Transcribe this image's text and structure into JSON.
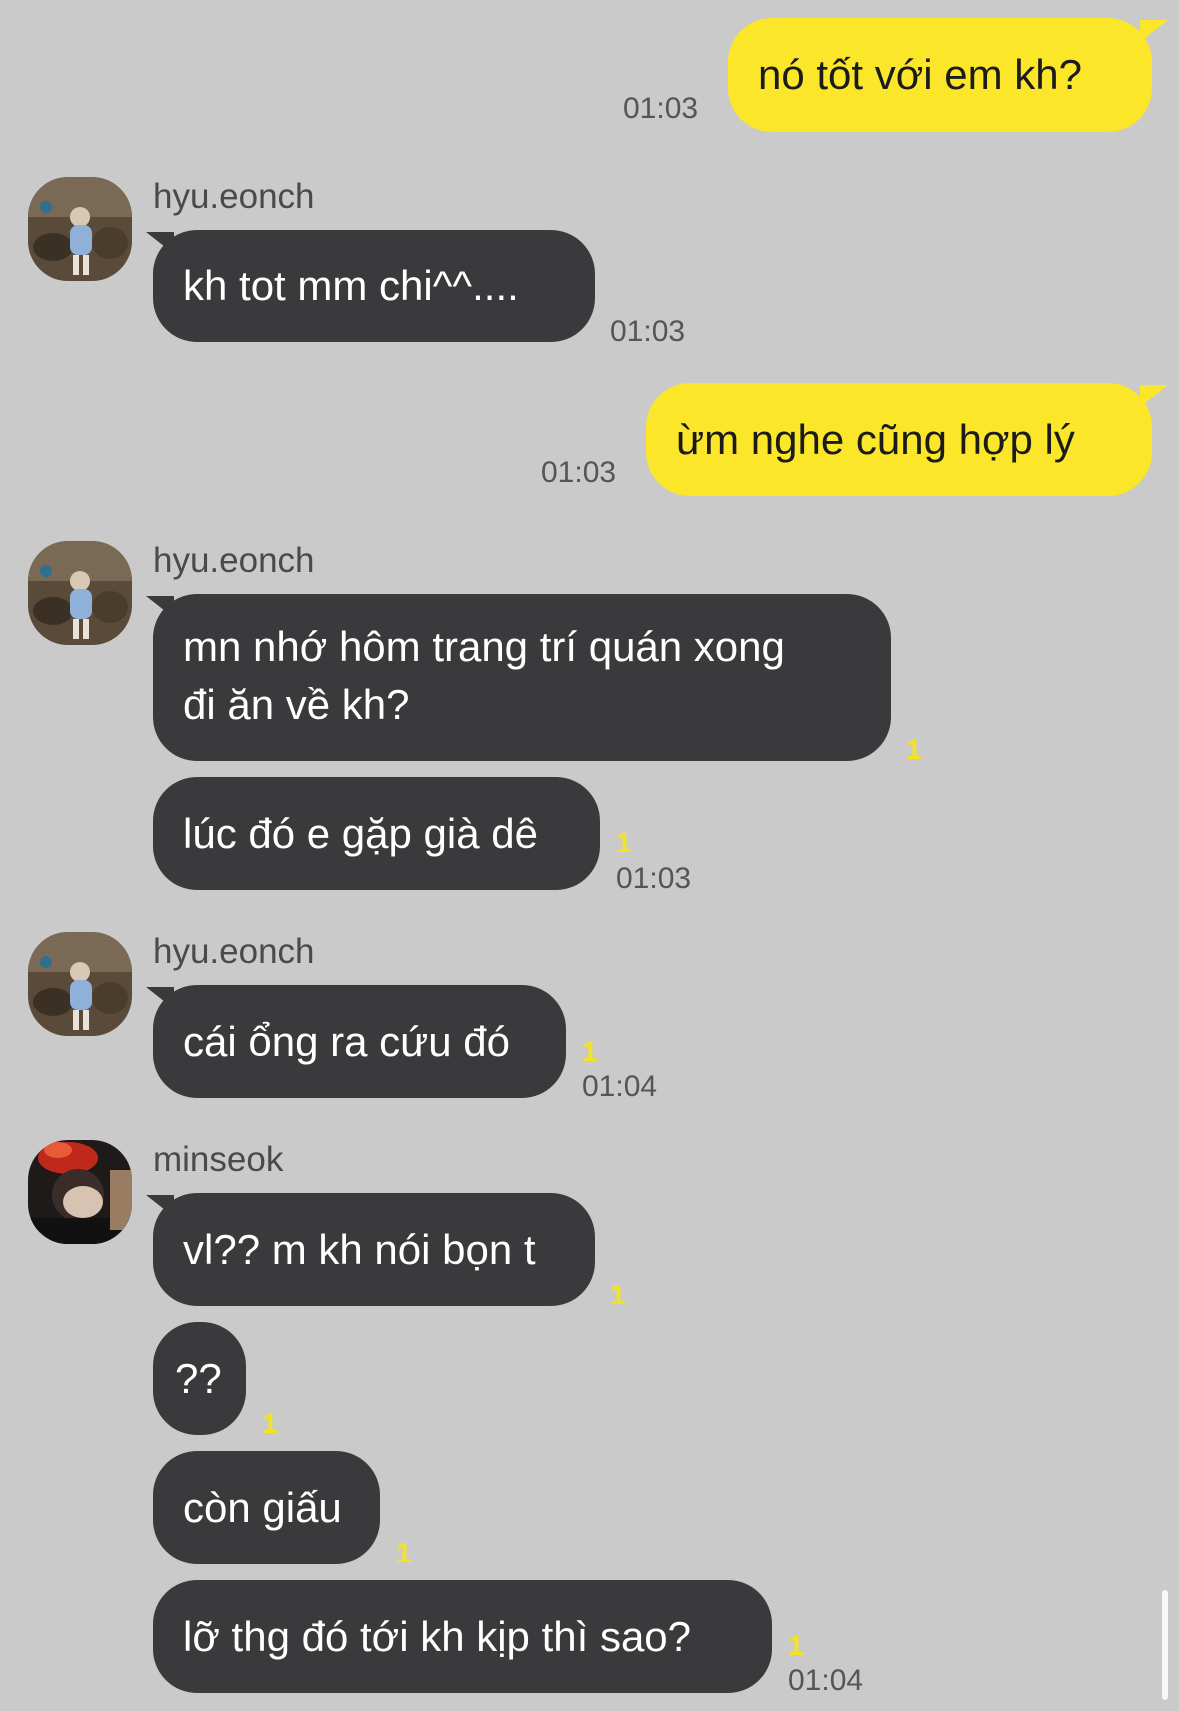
{
  "messages": {
    "m1": {
      "text": "nó tốt với em kh?",
      "time": "01:03"
    },
    "m2": {
      "sender": "hyu.eonch",
      "text": "kh tot mm chi^^....",
      "time": "01:03"
    },
    "m3": {
      "text": "ừm nghe cũng hợp lý",
      "time": "01:03"
    },
    "m4": {
      "sender": "hyu.eonch",
      "line1": "mn nhớ hôm trang trí quán xong",
      "line2": "đi ăn về kh?",
      "unread": "1"
    },
    "m5": {
      "text": "lúc đó e gặp già dê",
      "unread": "1",
      "time": "01:03"
    },
    "m6": {
      "sender": "hyu.eonch",
      "text": "cái ổng ra cứu đó",
      "unread": "1",
      "time": "01:04"
    },
    "m7": {
      "sender": "minseok",
      "text": "vl?? m kh nói bọn t",
      "unread": "1"
    },
    "m8": {
      "text": "??",
      "unread": "1"
    },
    "m9": {
      "text": "còn giấu",
      "unread": "1"
    },
    "m10": {
      "text": "lỡ thg đó tới kh kịp thì sao?",
      "unread": "1",
      "time": "01:04"
    }
  },
  "colors": {
    "background": "#cacaca",
    "outgoing_bubble": "#fbe62a",
    "incoming_bubble": "#3a3a3c",
    "unread_count": "#f4e31e"
  },
  "icons": {
    "avatar_hyu": "avatar-photo",
    "avatar_minseok": "avatar-photo"
  }
}
